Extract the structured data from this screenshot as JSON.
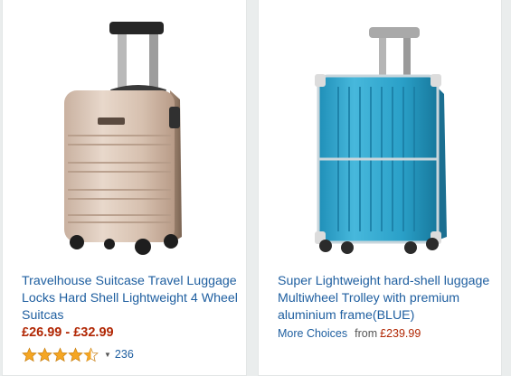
{
  "products": [
    {
      "title": "Travelhouse Suitcase Travel Luggage Locks Hard Shell Lightweight 4 Wheel Suitcas",
      "price_range": "£26.99 - £32.99",
      "rating_stars": 4.5,
      "rating_count": "236",
      "image_icon": "gold-hardshell-suitcase-image",
      "color": "#d8c3b3"
    },
    {
      "title": "Super Lightweight hard-shell luggage Multiwheel Trolley with premium aluminium frame(BLUE)",
      "more_choices_label": "More Choices",
      "from_label": "from",
      "from_price": "£239.99",
      "image_icon": "blue-aluminium-frame-suitcase-image",
      "color": "#2aa0c8"
    }
  ],
  "colors": {
    "link": "#1f5fa0",
    "price": "#b12704",
    "star": "#f5a623"
  }
}
